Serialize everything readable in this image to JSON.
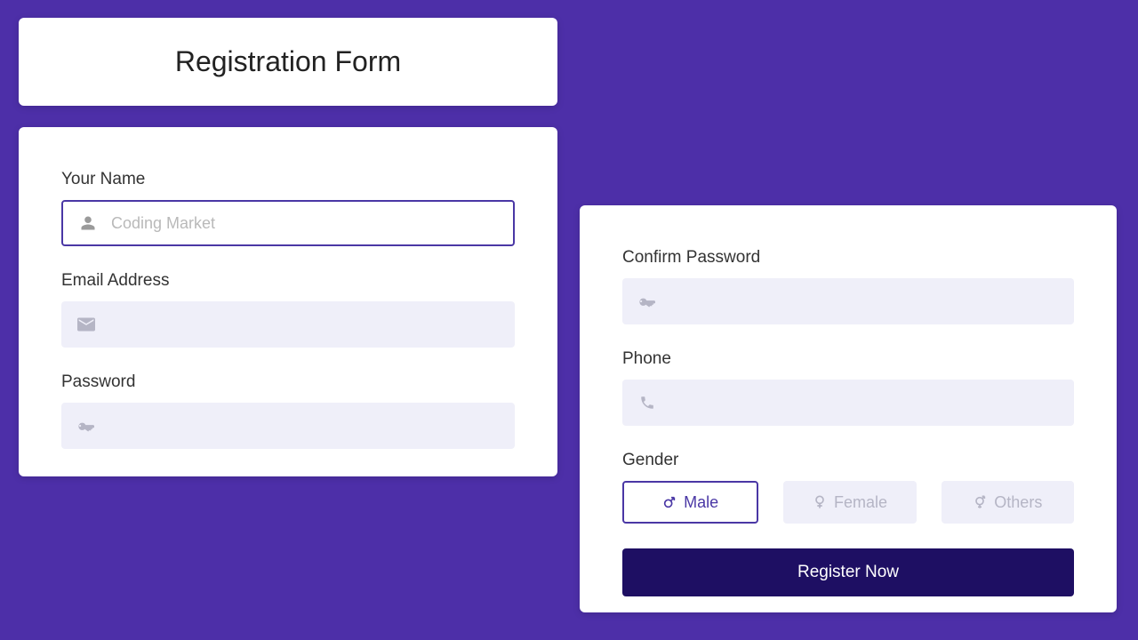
{
  "header": {
    "title": "Registration Form"
  },
  "left": {
    "name": {
      "label": "Your Name",
      "placeholder": "Coding Market"
    },
    "email": {
      "label": "Email Address",
      "placeholder": ""
    },
    "password": {
      "label": "Password",
      "placeholder": ""
    }
  },
  "right": {
    "confirmPassword": {
      "label": "Confirm Password",
      "placeholder": ""
    },
    "phone": {
      "label": "Phone",
      "placeholder": ""
    },
    "gender": {
      "label": "Gender",
      "options": {
        "male": "Male",
        "female": "Female",
        "others": "Others"
      },
      "selected": "male"
    },
    "submit": "Register Now"
  }
}
